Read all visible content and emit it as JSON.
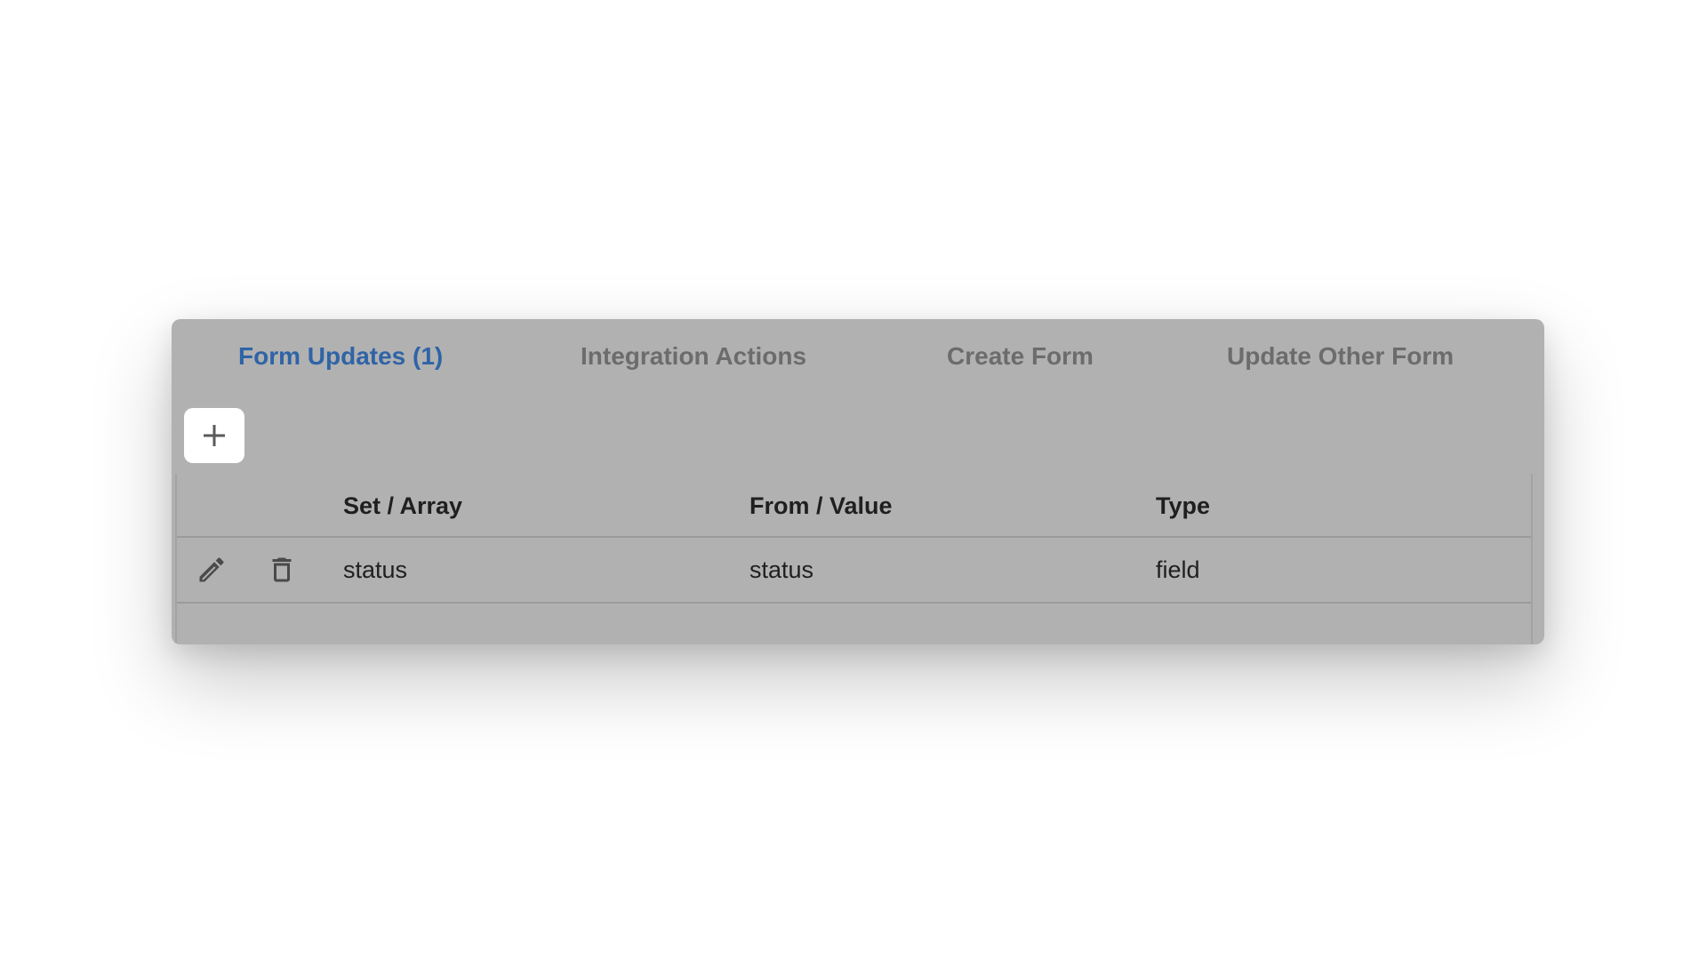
{
  "tabs": [
    {
      "label": "Form Updates (1)",
      "active": true
    },
    {
      "label": "Integration Actions",
      "active": false
    },
    {
      "label": "Create Form",
      "active": false
    },
    {
      "label": "Update Other Form",
      "active": false
    }
  ],
  "toolbar": {
    "add_icon": "plus-icon"
  },
  "table": {
    "columns": [
      "Set / Array",
      "From / Value",
      "Type"
    ],
    "rows": [
      {
        "set": "status",
        "from": "status",
        "type": "field",
        "actions": [
          "edit-icon",
          "delete-icon"
        ]
      }
    ]
  },
  "colors": {
    "active_tab": "#2f64a6",
    "inactive_tab": "#6c6c6c",
    "panel_background": "#b1b1b1"
  }
}
